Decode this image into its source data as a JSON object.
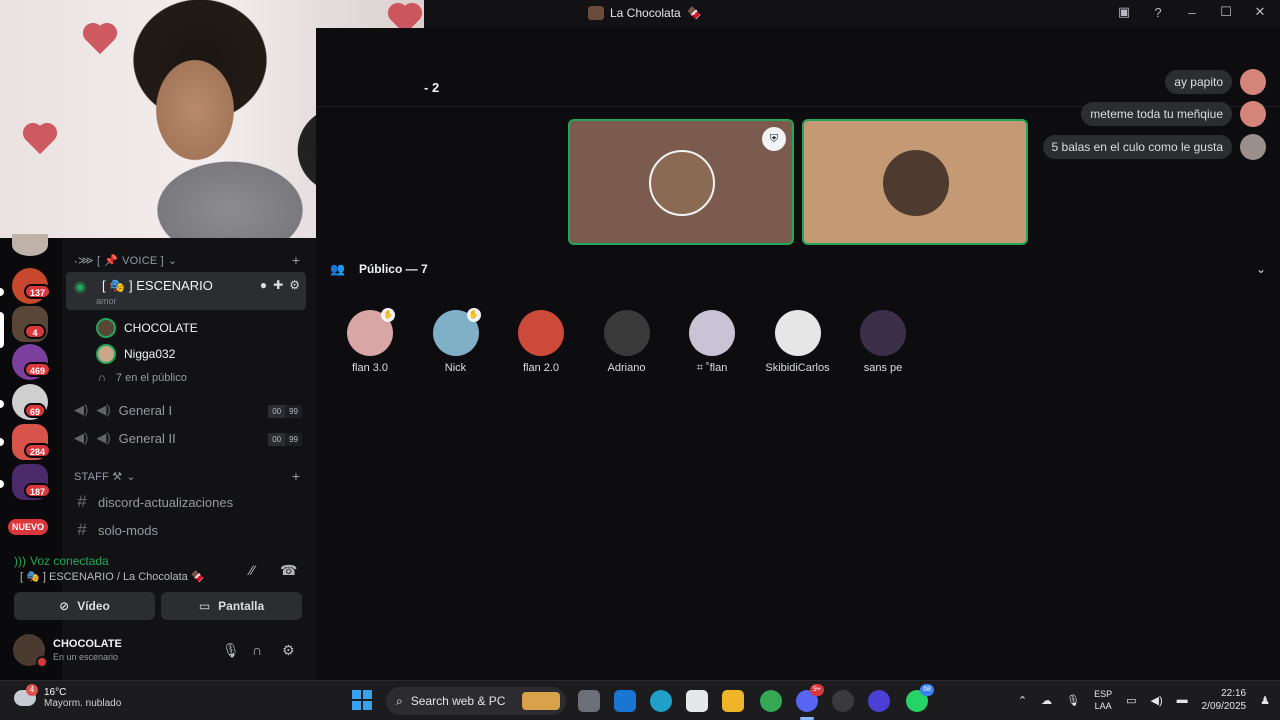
{
  "window": {
    "title": "La Chocolata",
    "title_emoji": "🍫"
  },
  "servers": [
    {
      "badge": "137",
      "color": "#c8482e"
    },
    {
      "badge": "4",
      "color": "#5a4636"
    },
    {
      "badge": "469",
      "color": "#7b3f9e"
    },
    {
      "badge": "69",
      "color": "#cfcfcf"
    },
    {
      "badge": "284",
      "color": "#d8534a"
    },
    {
      "badge": "187",
      "color": "#4b2a6b"
    }
  ],
  "rail_new_label": "NUEVO",
  "voice_category": {
    "prefix": "˖⋙ [",
    "icon": "📌",
    "label": "VOICE ]"
  },
  "stage": {
    "name": "ESCENARIO",
    "prefix": "[ 🎭 ]",
    "topic": "amor",
    "speakers": [
      {
        "name": "CHOCOLATE"
      },
      {
        "name": "Nigga032"
      }
    ],
    "audience": "7 en el público"
  },
  "voice_channels": [
    {
      "name": "General I",
      "count": "00",
      "limit": "99"
    },
    {
      "name": "General II",
      "count": "00",
      "limit": "99"
    }
  ],
  "staff_category": "STAFF ⚒",
  "text_channels": [
    {
      "name": "discord-actualizaciones"
    },
    {
      "name": "solo-mods"
    }
  ],
  "voice_panel": {
    "status": "Voz conectada",
    "location_prefix": "[ 🎭 ]",
    "location": "ESCENARIO / La Chocolata",
    "location_emoji": "🍫",
    "video_label": "Vídeo",
    "screen_label": "Pantalla"
  },
  "user": {
    "name": "CHOCOLATE",
    "status": "En un escenario"
  },
  "main": {
    "speaker_count": "2",
    "messages": [
      {
        "text": "ay papito"
      },
      {
        "text": "meteme toda tu meñqiue"
      },
      {
        "text": "5 balas en el culo como le gusta"
      }
    ],
    "audience_header": "Público — 7",
    "members": [
      {
        "name": "flan 3.0",
        "hand": true,
        "color": "#d9a6a6"
      },
      {
        "name": "Nick",
        "hand": true,
        "color": "#7fb0c8"
      },
      {
        "name": "flan 2.0",
        "hand": false,
        "color": "#cc4a3a"
      },
      {
        "name": "Adriano",
        "hand": false,
        "color": "#3a3a3a"
      },
      {
        "name": "⌗ ˚flan",
        "hand": false,
        "color": "#c9c3d6"
      },
      {
        "name": "SkibidiCarlos",
        "hand": false,
        "color": "#e6e6e6"
      },
      {
        "name": "sans pe",
        "hand": false,
        "color": "#3b2f4a"
      }
    ]
  },
  "taskbar": {
    "temp": "16°C",
    "weather_text": "Mayorm. nublado",
    "weather_badge": "4",
    "search_placeholder": "Search web & PC",
    "discord_badge": "9+",
    "whatsapp_badge": "68",
    "lang_top": "ESP",
    "lang_bottom": "LAA",
    "time": "22:16",
    "date": "2/09/2025"
  },
  "colors": {
    "accent_green": "#23a55a",
    "danger_red": "#da373c"
  }
}
